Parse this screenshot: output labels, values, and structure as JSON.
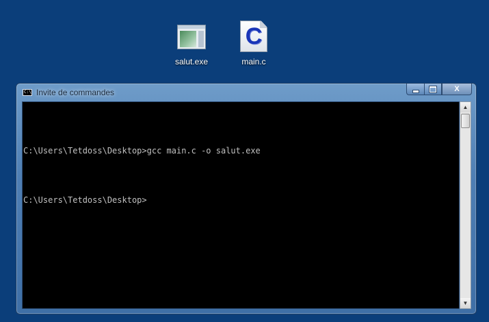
{
  "desktop": {
    "icons": [
      {
        "label": "salut.exe",
        "icon": "application-icon"
      },
      {
        "label": "main.c",
        "icon": "c-source-file-icon",
        "glyph": "C"
      }
    ]
  },
  "window": {
    "title": "Invite de commandes",
    "title_icon_text": "C:\\",
    "buttons": {
      "close_glyph": "X"
    },
    "console": {
      "lines": [
        "C:\\Users\\Tetdoss\\Desktop>gcc main.c -o salut.exe",
        "C:\\Users\\Tetdoss\\Desktop>"
      ]
    },
    "scrollbar": {
      "up_glyph": "▲",
      "down_glyph": "▼"
    }
  },
  "colors": {
    "desktop_background": "#0b3e7a",
    "console_background": "#000000",
    "console_text": "#c0c0c0",
    "c_icon_letter": "#1a36b8"
  }
}
